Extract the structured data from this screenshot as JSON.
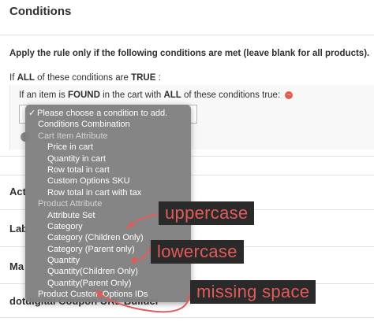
{
  "section": {
    "title": "Conditions"
  },
  "intro": "Apply the rule only if the following conditions are met (leave blank for all products).",
  "root_condition": {
    "prefix": "If",
    "aggregator": "ALL",
    "middle": "of these conditions are",
    "value": "TRUE",
    "suffix": ":"
  },
  "child_condition": {
    "prefix": "If an item is",
    "found": "FOUND",
    "middle": "in the cart with",
    "aggregator": "ALL",
    "suffix": "of these conditions true:"
  },
  "rows": [
    {
      "label": "Act"
    },
    {
      "label": "Lab"
    },
    {
      "label": "Ma"
    },
    {
      "label": "dotdigital Coupon URL Builder"
    }
  ],
  "dropdown": {
    "selected": "Please choose a condition to add.",
    "items": [
      {
        "label": "Conditions Combination",
        "kind": "top"
      },
      {
        "label": "Cart Item Attribute",
        "kind": "group"
      },
      {
        "label": "Price in cart",
        "kind": "sub"
      },
      {
        "label": "Quantity in cart",
        "kind": "sub"
      },
      {
        "label": "Row total in cart",
        "kind": "sub"
      },
      {
        "label": "Custom Options SKU",
        "kind": "sub"
      },
      {
        "label": "Row total in cart with tax",
        "kind": "sub"
      },
      {
        "label": "Product Attribute",
        "kind": "group"
      },
      {
        "label": "Attribute Set",
        "kind": "sub"
      },
      {
        "label": "Category",
        "kind": "sub"
      },
      {
        "label": "Category (Children Only)",
        "kind": "sub"
      },
      {
        "label": "Category (Parent only)",
        "kind": "sub"
      },
      {
        "label": "Quantity",
        "kind": "sub"
      },
      {
        "label": "Quantity(Children Only)",
        "kind": "sub"
      },
      {
        "label": "Quantity(Parent Only)",
        "kind": "sub"
      },
      {
        "label": "Product Custom Options IDs",
        "kind": "top"
      }
    ]
  },
  "annotations": {
    "uppercase": "uppercase",
    "lowercase": "lowercase",
    "missing_space": "missing space",
    "color": "#e25b5b"
  }
}
